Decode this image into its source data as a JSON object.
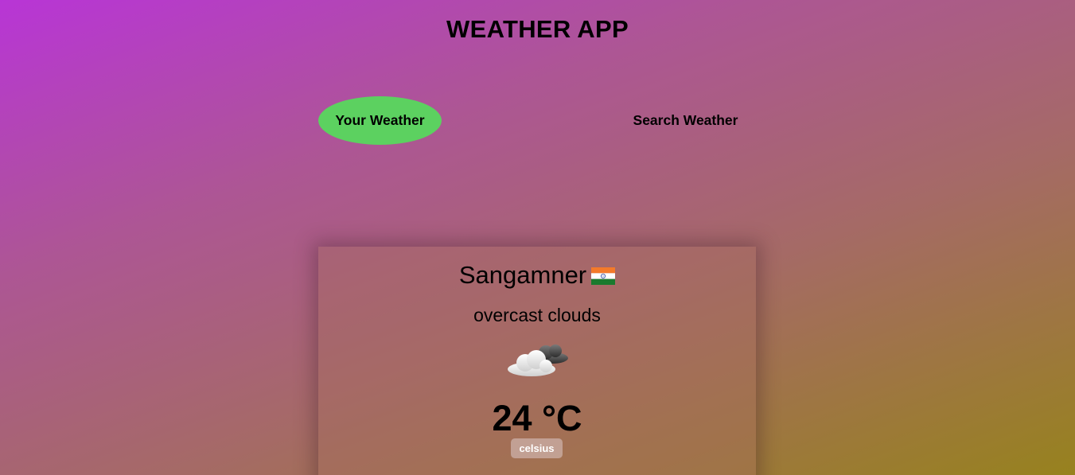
{
  "header": {
    "title": "WEATHER APP"
  },
  "tabs": [
    {
      "label": "Your Weather",
      "active": true
    },
    {
      "label": "Search Weather",
      "active": false
    }
  ],
  "weather": {
    "city": "Sangamner",
    "country_flag_icon": "india-flag-icon",
    "description": "overcast clouds",
    "condition_icon": "cloud-icon",
    "temperature": "24 °C",
    "unit_label": "celsius"
  },
  "colors": {
    "background_gradient": [
      "#b835d6",
      "#ad5694",
      "#a56a66",
      "#97821e"
    ],
    "active_tab": "#5cd160"
  }
}
